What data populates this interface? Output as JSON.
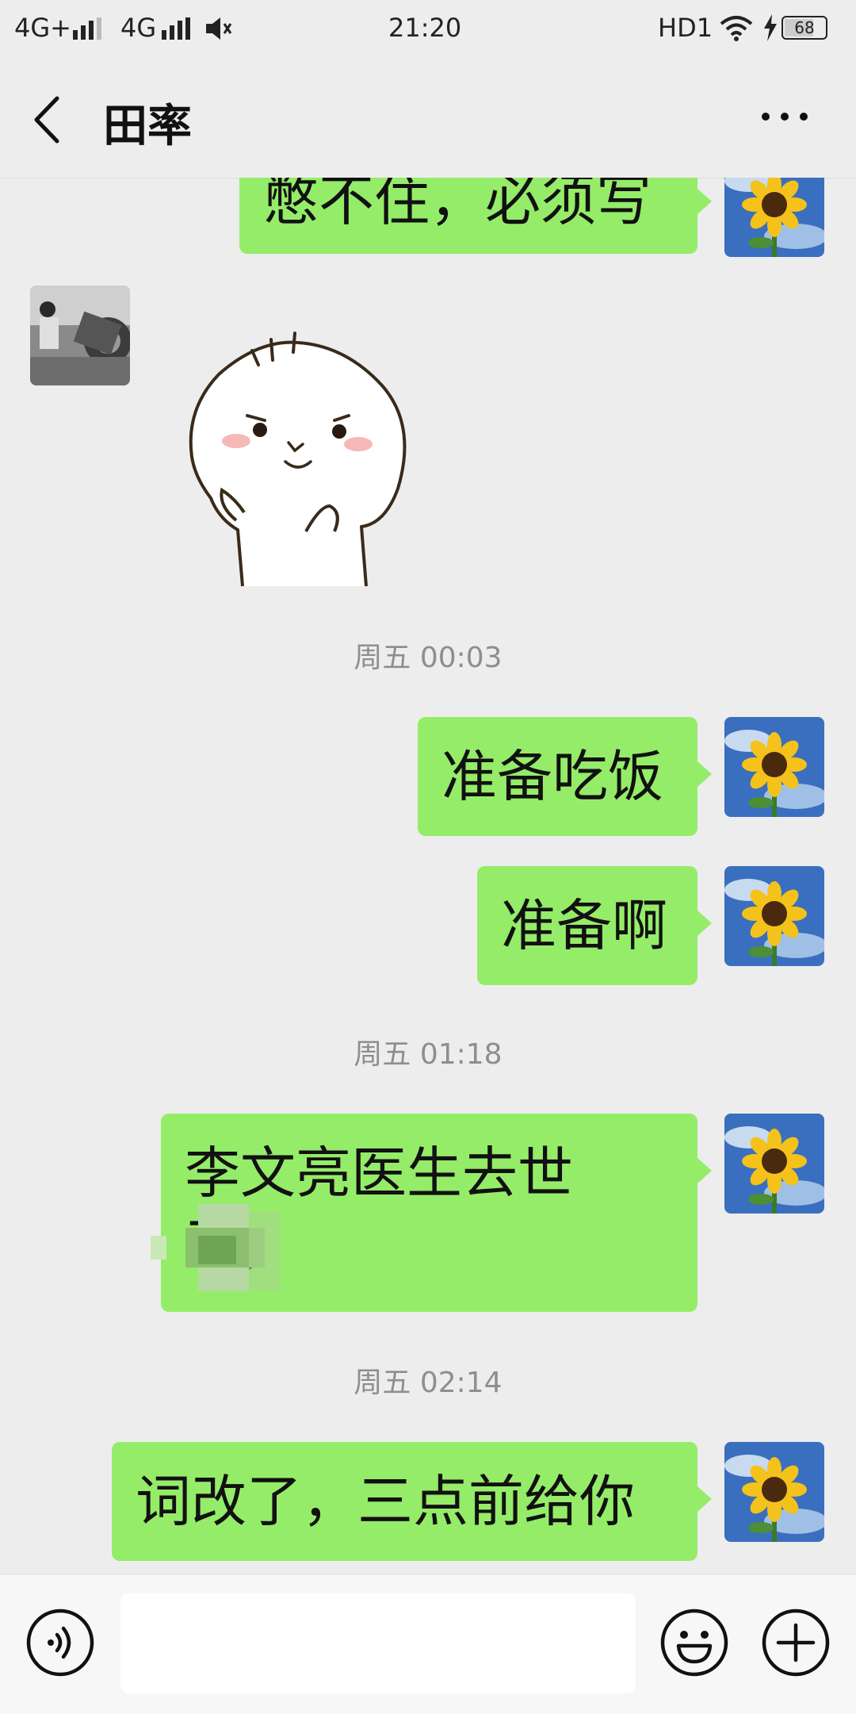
{
  "status_bar": {
    "signal_left": "4G+",
    "signal_right": "4G",
    "time": "21:20",
    "hd": "HD1",
    "battery": "68"
  },
  "header": {
    "title": "田率"
  },
  "messages": {
    "m1_text": "憋不住，必须写",
    "ts1": "周五 00:03",
    "m2_text": "准备吃饭",
    "m3_text": "准备啊",
    "ts2": "周五 01:18",
    "m4_text": "李文亮医生去世了，",
    "ts3": "周五 02:14",
    "m5_text": "词改了，三点前给你"
  },
  "input": {
    "placeholder": ""
  },
  "colors": {
    "bubble_green": "#95ec69",
    "background": "#ededed"
  }
}
